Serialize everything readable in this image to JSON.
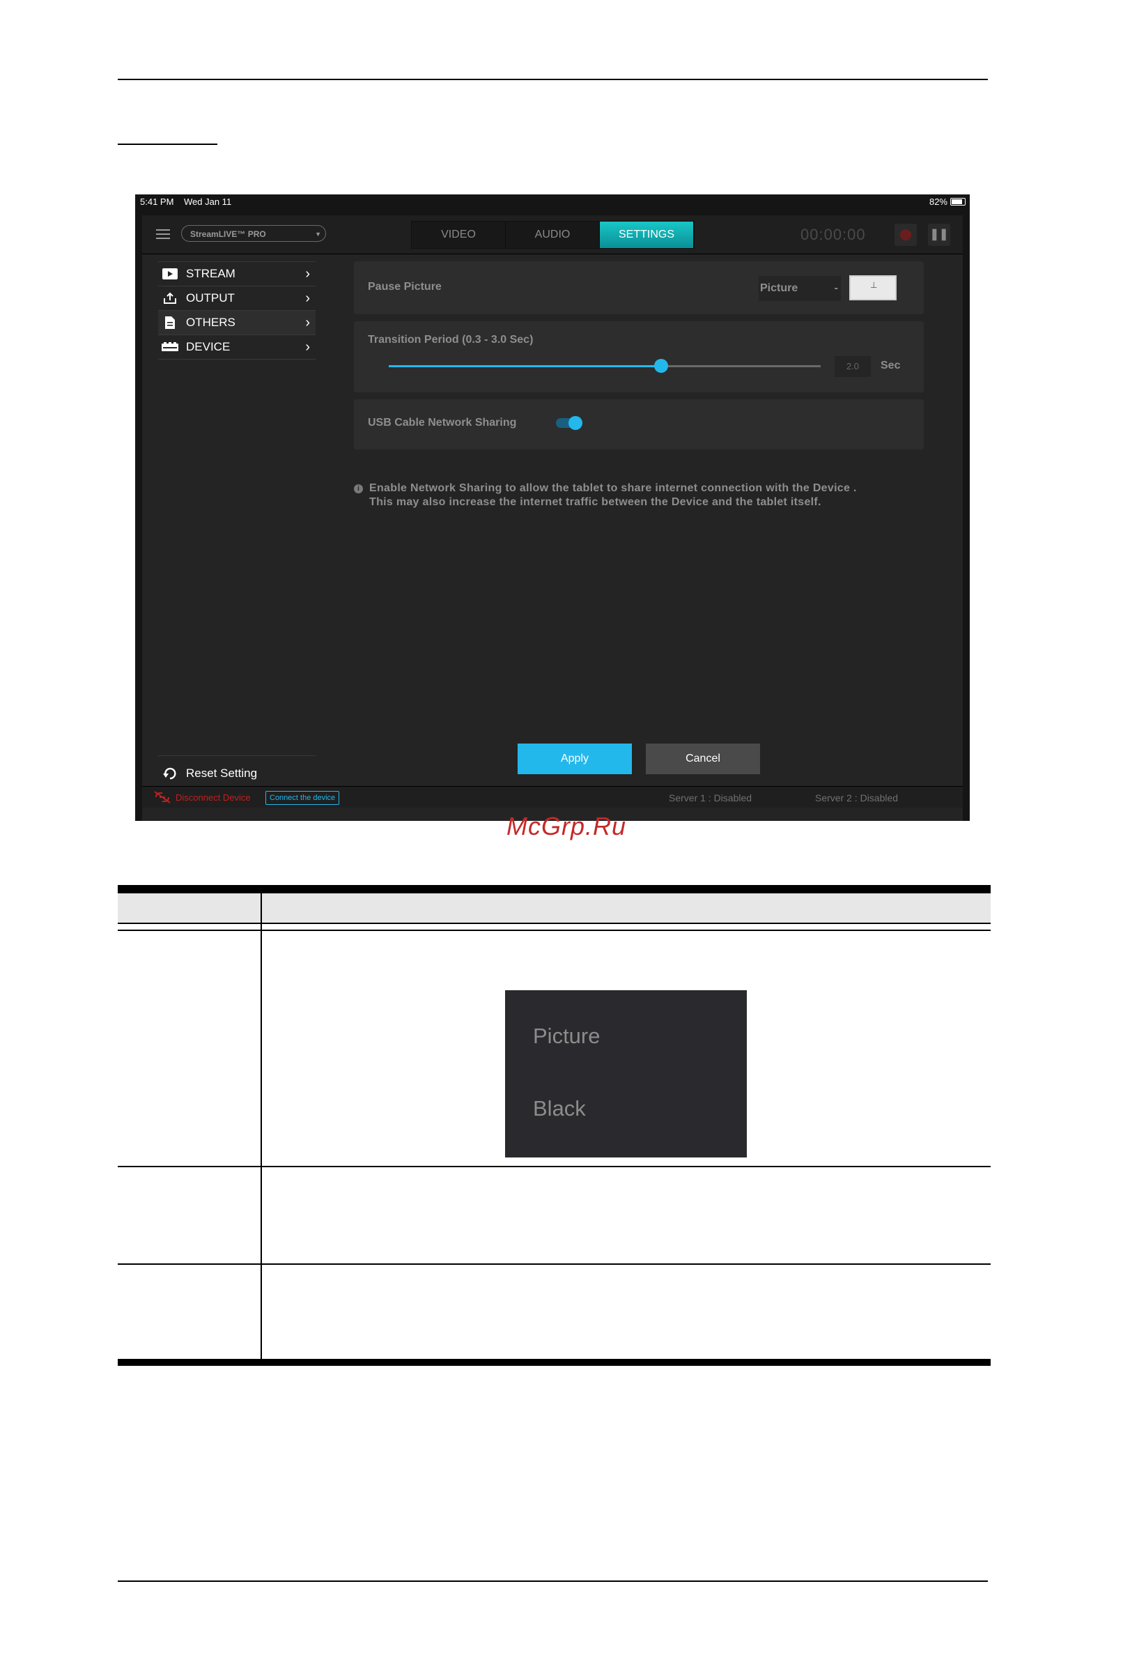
{
  "status_bar": {
    "time": "5:41 PM",
    "date": "Wed Jan 11",
    "battery": "82%"
  },
  "topbar": {
    "device": "StreamLIVE™ PRO",
    "tabs": [
      "VIDEO",
      "AUDIO",
      "SETTINGS"
    ],
    "active_tab": "SETTINGS",
    "timer": "00:00:00"
  },
  "sidebar": {
    "items": [
      {
        "label": "STREAM",
        "icon": "play-icon"
      },
      {
        "label": "OUTPUT",
        "icon": "upload-icon"
      },
      {
        "label": "OTHERS",
        "icon": "document-icon"
      },
      {
        "label": "DEVICE",
        "icon": "device-icon"
      }
    ],
    "active_item": "OTHERS",
    "reset_label": "Reset Setting"
  },
  "settings": {
    "pause_picture": {
      "label": "Pause Picture",
      "value": "Picture",
      "separator": "-"
    },
    "transition": {
      "label": "Transition Period (0.3 - 3.0 Sec)",
      "value": "2.0",
      "unit": "Sec",
      "min": 0.3,
      "max": 3.0,
      "fraction": 0.63
    },
    "usb_sharing": {
      "label": "USB Cable Network Sharing",
      "enabled": true
    },
    "info_lines": [
      "Enable Network Sharing to allow the tablet to share internet connection with the Device .",
      "This may also increase the internet traffic between the Device  and the tablet itself."
    ]
  },
  "buttons": {
    "apply": "Apply",
    "cancel": "Cancel"
  },
  "footer": {
    "disconnect": "Disconnect Device",
    "connect": "Connect the device",
    "server1": "Server 1 :   Disabled",
    "server2": "Server 2 :   Disabled"
  },
  "watermark": "McGrp.Ru",
  "menu_options": [
    "Picture",
    "Black"
  ],
  "colors": {
    "accent": "#23b8ec",
    "tab_active": "#13b5b8",
    "disconnect": "#c12020",
    "watermark": "#c32a2a"
  }
}
